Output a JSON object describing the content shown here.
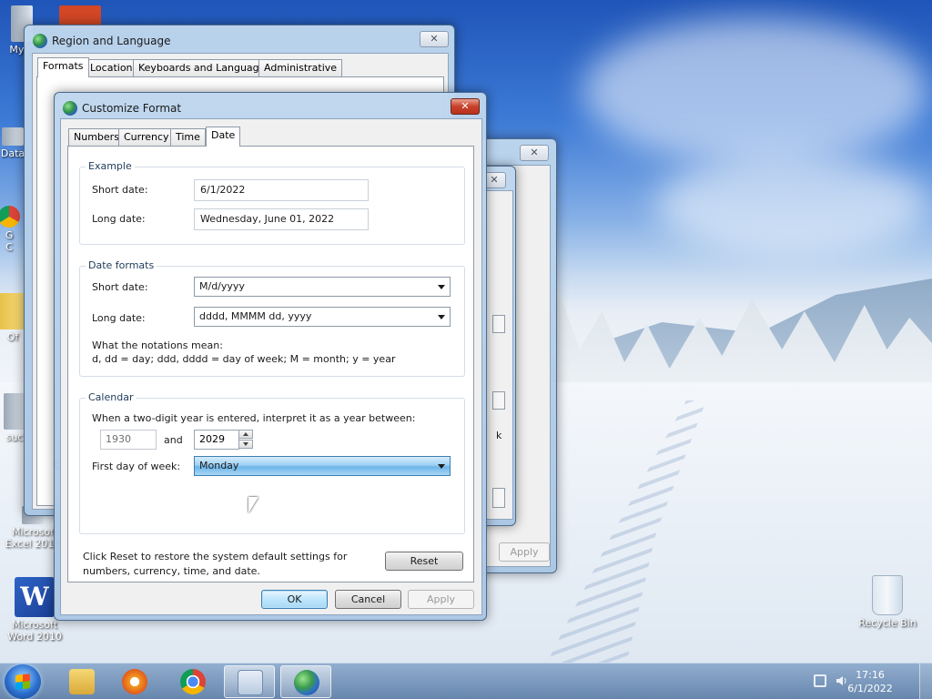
{
  "desktop": {
    "icons": [
      {
        "label": "My C",
        "icon": "computer-icon"
      },
      {
        "label": "Data",
        "icon": "shortcut-icon"
      },
      {
        "label": "G",
        "icon": "chrome-shortcut-icon"
      },
      {
        "label": "C",
        "icon": "shortcut-icon"
      },
      {
        "label": "Of",
        "icon": "folder-icon"
      },
      {
        "label": "suc",
        "icon": "file-icon"
      },
      {
        "label": "Microsof",
        "label2": "Excel 2010",
        "icon": "excel-icon"
      },
      {
        "label": "Microsoft",
        "label2": "Word 2010",
        "icon": "word-icon"
      },
      {
        "label": "Recycle Bin",
        "icon": "recycle-bin-icon"
      }
    ]
  },
  "region_window": {
    "title": "Region and Language",
    "tabs": [
      "Formats",
      "Location",
      "Keyboards and Languages",
      "Administrative"
    ],
    "active_tab": "Formats",
    "close_label": "✕",
    "partial_texts": {
      "f": "F",
      "c": "C"
    }
  },
  "back_window": {
    "close_label": "✕",
    "apply_label": "Apply",
    "partial_k": "k"
  },
  "customize_window": {
    "title": "Customize Format",
    "close_label": "✕",
    "tabs": [
      "Numbers",
      "Currency",
      "Time",
      "Date"
    ],
    "active_tab": "Date",
    "example": {
      "title": "Example",
      "short_label": "Short date:",
      "short_value": "6/1/2022",
      "long_label": "Long date:",
      "long_value": "Wednesday, June 01, 2022"
    },
    "date_formats": {
      "title": "Date formats",
      "short_label": "Short date:",
      "short_value": "M/d/yyyy",
      "long_label": "Long date:",
      "long_value": "dddd, MMMM dd, yyyy",
      "notation_title": "What the notations mean:",
      "notation_text": "d, dd = day;  ddd, dddd = day of week;  M = month;  y = year"
    },
    "calendar": {
      "title": "Calendar",
      "instruction": "When a two-digit year is entered, interpret it as a year between:",
      "year_start": "1930",
      "and_label": "and",
      "year_end": "2029",
      "first_day_label": "First day of week:",
      "first_day_value": "Monday"
    },
    "reset_text_1": "Click Reset to restore the system default settings for",
    "reset_text_2": "numbers, currency, time, and date.",
    "reset_label": "Reset",
    "ok_label": "OK",
    "cancel_label": "Cancel",
    "apply_label": "Apply"
  },
  "taskbar": {
    "items": [
      "windows-explorer-icon",
      "media-player-icon",
      "chrome-icon",
      "calendar-control-icon",
      "region-globe-icon"
    ],
    "time": "17:16",
    "date": "6/1/2022"
  }
}
